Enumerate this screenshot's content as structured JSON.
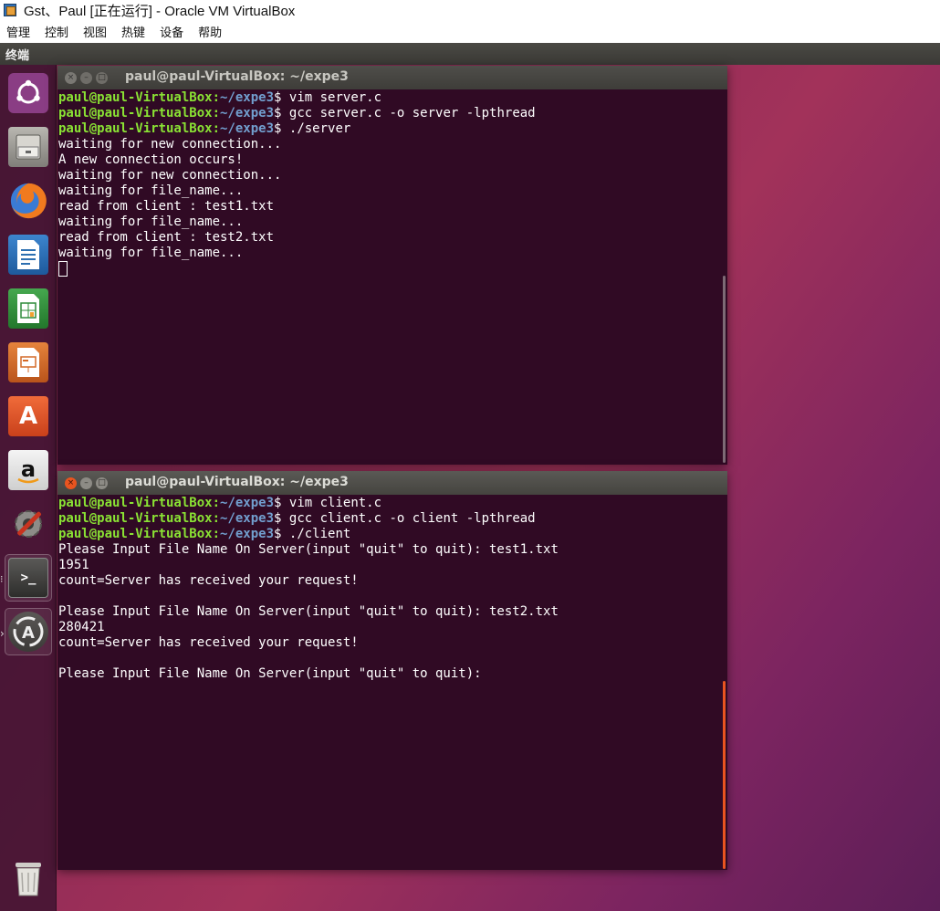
{
  "host_window": {
    "title": "Gst、Paul [正在运行] - Oracle VM VirtualBox",
    "menu": [
      "管理",
      "控制",
      "视图",
      "热键",
      "设备",
      "帮助"
    ]
  },
  "guest_topbar": {
    "app_name": "终端"
  },
  "launcher": {
    "items": [
      {
        "name": "ubuntu-dash",
        "icon": "ubuntu-logo-icon",
        "color": "#8a3d84"
      },
      {
        "name": "files",
        "icon": "file-cabinet-icon",
        "color": "#8c8a85"
      },
      {
        "name": "firefox",
        "icon": "firefox-icon",
        "color": "#e8652c"
      },
      {
        "name": "libreoffice-writer",
        "icon": "writer-document-icon",
        "color": "#2c6fb1"
      },
      {
        "name": "libreoffice-calc",
        "icon": "calc-spreadsheet-icon",
        "color": "#2e8b3a"
      },
      {
        "name": "libreoffice-impress",
        "icon": "impress-presentation-icon",
        "color": "#d46a28"
      },
      {
        "name": "ubuntu-software",
        "icon": "software-bag-icon",
        "color": "#e4572e"
      },
      {
        "name": "amazon",
        "icon": "amazon-icon",
        "color": "#e0e0e0"
      },
      {
        "name": "system-settings",
        "icon": "gear-wrench-icon",
        "color": "#6f6e6a"
      },
      {
        "name": "terminal",
        "icon": "terminal-icon",
        "color": "#3a3a38"
      },
      {
        "name": "software-updater",
        "icon": "software-updater-icon",
        "color": "#4d4a48"
      },
      {
        "name": "trash",
        "icon": "trash-icon",
        "color": "#7a7976"
      }
    ],
    "pip_labels": [
      "⁝",
      "›"
    ]
  },
  "server_terminal": {
    "title": "paul@paul-VirtualBox: ~/expe3",
    "lines": [
      {
        "user": "paul@paul-VirtualBox",
        "path": "~/expe3",
        "cmd": "$ vim server.c"
      },
      {
        "user": "paul@paul-VirtualBox",
        "path": "~/expe3",
        "cmd": "$ gcc server.c -o server -lpthread"
      },
      {
        "user": "paul@paul-VirtualBox",
        "path": "~/expe3",
        "cmd": "$ ./server"
      },
      {
        "text": "waiting for new connection..."
      },
      {
        "text": "A new connection occurs!"
      },
      {
        "text": "waiting for new connection..."
      },
      {
        "text": "waiting for file_name..."
      },
      {
        "text": "read from client : test1.txt"
      },
      {
        "text": "waiting for file_name..."
      },
      {
        "text": "read from client : test2.txt"
      },
      {
        "text": "waiting for file_name..."
      }
    ]
  },
  "client_terminal": {
    "title": "paul@paul-VirtualBox: ~/expe3",
    "lines": [
      {
        "user": "paul@paul-VirtualBox",
        "path": "~/expe3",
        "cmd": "$ vim client.c"
      },
      {
        "user": "paul@paul-VirtualBox",
        "path": "~/expe3",
        "cmd": "$ gcc client.c -o client -lpthread"
      },
      {
        "user": "paul@paul-VirtualBox",
        "path": "~/expe3",
        "cmd": "$ ./client"
      },
      {
        "text": "Please Input File Name On Server(input \"quit\" to quit): test1.txt"
      },
      {
        "text": "1951"
      },
      {
        "text": "count=Server has received your request!"
      },
      {
        "text": ""
      },
      {
        "text": "Please Input File Name On Server(input \"quit\" to quit): test2.txt"
      },
      {
        "text": "280421"
      },
      {
        "text": "count=Server has received your request!"
      },
      {
        "text": ""
      },
      {
        "text": "Please Input File Name On Server(input \"quit\" to quit): "
      }
    ]
  },
  "colors": {
    "terminal_bg": "#300a24",
    "prompt_user": "#8ae234",
    "prompt_path": "#729fcf",
    "close_button": "#e9541f",
    "active_scrollbar": "#e95420"
  }
}
